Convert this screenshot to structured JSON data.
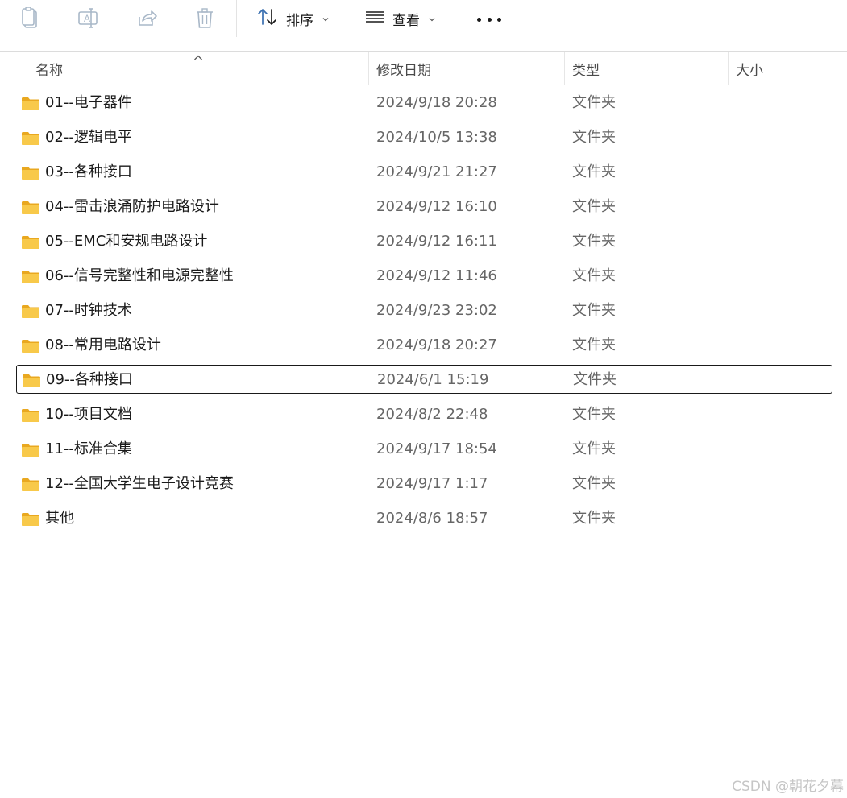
{
  "toolbar": {
    "icons": [
      "paste-icon",
      "rename-icon",
      "share-icon",
      "delete-icon"
    ],
    "sort_label": "排序",
    "view_label": "查看",
    "more_label": "更多"
  },
  "header": {
    "name": "名称",
    "modified": "修改日期",
    "type": "类型",
    "size": "大小"
  },
  "files": [
    {
      "name": "01--电子器件",
      "modified": "2024/9/18 20:28",
      "type": "文件夹",
      "size": ""
    },
    {
      "name": "02--逻辑电平",
      "modified": "2024/10/5 13:38",
      "type": "文件夹",
      "size": ""
    },
    {
      "name": "03--各种接口",
      "modified": "2024/9/21 21:27",
      "type": "文件夹",
      "size": ""
    },
    {
      "name": "04--雷击浪涌防护电路设计",
      "modified": "2024/9/12 16:10",
      "type": "文件夹",
      "size": ""
    },
    {
      "name": "05--EMC和安规电路设计",
      "modified": "2024/9/12 16:11",
      "type": "文件夹",
      "size": ""
    },
    {
      "name": "06--信号完整性和电源完整性",
      "modified": "2024/9/12 11:46",
      "type": "文件夹",
      "size": ""
    },
    {
      "name": "07--时钟技术",
      "modified": "2024/9/23 23:02",
      "type": "文件夹",
      "size": ""
    },
    {
      "name": "08--常用电路设计",
      "modified": "2024/9/18 20:27",
      "type": "文件夹",
      "size": ""
    },
    {
      "name": "09--各种接口",
      "modified": "2024/6/1 15:19",
      "type": "文件夹",
      "size": "",
      "focused": true
    },
    {
      "name": "10--项目文档",
      "modified": "2024/8/2 22:48",
      "type": "文件夹",
      "size": ""
    },
    {
      "name": "11--标准合集",
      "modified": "2024/9/17 18:54",
      "type": "文件夹",
      "size": ""
    },
    {
      "name": "12--全国大学生电子设计竞赛",
      "modified": "2024/9/17 1:17",
      "type": "文件夹",
      "size": ""
    },
    {
      "name": "其他",
      "modified": "2024/8/6 18:57",
      "type": "文件夹",
      "size": ""
    }
  ],
  "watermark": "CSDN @朝花夕幕",
  "colors": {
    "folder": "#F8C94A",
    "folder_dark": "#E9A820",
    "focus_border": "#1A1A1A",
    "disabled_icon": "#A9B8C8"
  }
}
